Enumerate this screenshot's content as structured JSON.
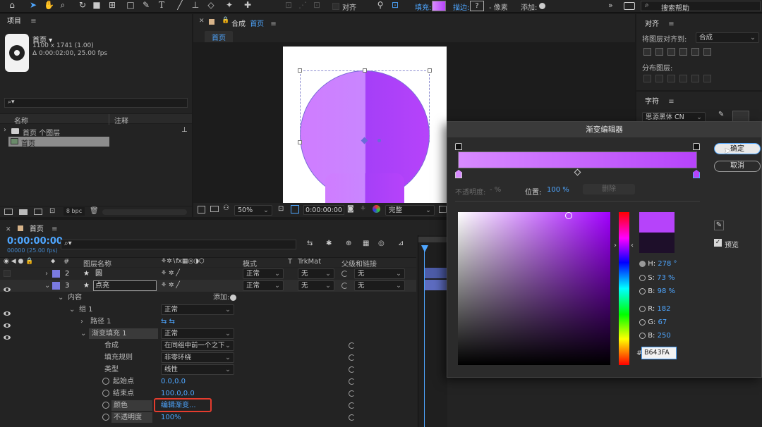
{
  "toolbar": {
    "align_label": "对齐",
    "fill_label": "填充:",
    "stroke_label": "描边:",
    "stroke_value": "?",
    "stroke_unit": "- 像素",
    "add_label": "添加:",
    "search_placeholder": "搜索帮助"
  },
  "project": {
    "title": "项目",
    "item_name": "首页 ▾",
    "item_size": "1100 x 1741 (1.00)",
    "item_duration": "Δ 0:00:02:00, 25.00 fps",
    "search_icon_text": "⌕▾",
    "col_name": "名称",
    "col_comment": "注释",
    "folder_item": "首页 个图层",
    "comp_item": "首页",
    "bpc": "8 bpc"
  },
  "composition": {
    "tab_label": "合成",
    "tab_name": "首页",
    "breadcrumb": "首页",
    "zoom": "50%",
    "timecode": "0:00:00:00",
    "quality": "完整"
  },
  "align_panel": {
    "title": "对齐",
    "align_to_label": "将图层对齐到:",
    "align_to_value": "合成",
    "distribute_label": "分布图层:",
    "char_title": "字符",
    "font_value": "思源黑体 CN"
  },
  "timeline": {
    "tab_name": "首页",
    "timecode": "0:00:00:00",
    "timecode_sub": "00000 (25.00 fps)",
    "col_layer_name": "图层名称",
    "col_mode": "模式",
    "col_t": "T",
    "col_trkmat": "TrkMat",
    "col_parent": "父级和链接",
    "layers": [
      {
        "num": "2",
        "name": "圆",
        "mode": "正常",
        "trkmat": "无",
        "parent": "无"
      },
      {
        "num": "3",
        "name": "点亮",
        "mode": "正常",
        "trkmat": "无",
        "parent": "无"
      }
    ],
    "contents_label": "内容",
    "add_label": "添加:",
    "group_label": "组 1",
    "group_mode": "正常",
    "path_label": "路径 1",
    "gradfill_label": "渐变填充 1",
    "gradfill_mode": "正常",
    "composite_label": "合成",
    "composite_value": "在同组中前一个之下",
    "fillrule_label": "填充规则",
    "fillrule_value": "非零环绕",
    "type_label": "类型",
    "type_value": "线性",
    "start_label": "起始点",
    "start_value": "0.0,0.0",
    "end_label": "结束点",
    "end_value": "100.0,0.0",
    "color_label": "颜色",
    "color_value": "编辑渐变...",
    "opacity_label": "不透明度",
    "opacity_value": "100%"
  },
  "gradient_editor": {
    "title": "渐变编辑器",
    "ok_label": "确定",
    "cancel_label": "取消",
    "opacity_label": "不透明度:",
    "opacity_value": "- %",
    "location_label": "位置:",
    "location_value": "100 %",
    "delete_label": "删除",
    "preview_label": "预览",
    "h_label": "H:",
    "h_value": "278 °",
    "s_label": "S:",
    "s_value": "73 %",
    "b_label": "B:",
    "b_value": "98 %",
    "r_label": "R:",
    "r_value": "182",
    "g_label": "G:",
    "g_value": "67",
    "bb_label": "B:",
    "bb_value": "250",
    "hex_label": "#",
    "hex_value": "B643FA"
  },
  "colors": {
    "accent": "#4ea6ff",
    "gradient_start": "#d88bff",
    "gradient_end": "#b643fa",
    "highlight_box": "#e53c2e"
  }
}
